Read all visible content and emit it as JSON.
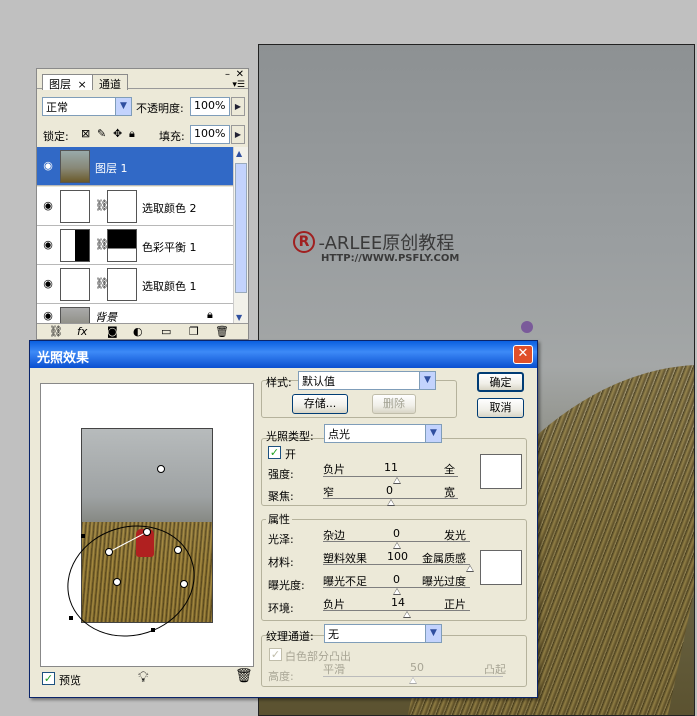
{
  "watermark": {
    "brand": "-ARLEE原创教程",
    "logo": "R",
    "url": "HTTP://WWW.PSFLY.COM"
  },
  "layers_panel": {
    "tabs": [
      "图层",
      "通道"
    ],
    "tab_close": "×",
    "blend_mode": "正常",
    "opacity_label": "不透明度:",
    "opacity_value": "100%",
    "lock_label": "锁定:",
    "fill_label": "填充:",
    "fill_value": "100%",
    "layers": [
      {
        "name": "图层 1",
        "selected": true
      },
      {
        "name": "选取颜色 2",
        "selected": false
      },
      {
        "name": "色彩平衡 1",
        "selected": false
      },
      {
        "name": "选取颜色 1",
        "selected": false
      },
      {
        "name": "背景",
        "selected": false
      }
    ]
  },
  "dialog": {
    "title": "光照效果",
    "close": "✕",
    "ok": "确定",
    "cancel": "取消",
    "style_label": "样式:",
    "style_value": "默认值",
    "save": "存储...",
    "delete": "删除",
    "light_type_label": "光照类型:",
    "light_type_value": "点光",
    "on_label": "开",
    "intensity": {
      "label": "强度:",
      "left": "负片",
      "value": "11",
      "right": "全",
      "level": 0.55
    },
    "focus": {
      "label": "聚焦:",
      "left": "窄",
      "value": "0",
      "right": "宽",
      "level": 0.5
    },
    "properties_label": "属性",
    "gloss": {
      "label": "光泽:",
      "left": "杂边",
      "value": "0",
      "right": "发光",
      "level": 0.5
    },
    "material": {
      "label": "材料:",
      "left": "塑料效果",
      "value": "100",
      "right": "金属质感",
      "level": 1.0
    },
    "exposure": {
      "label": "曝光度:",
      "left": "曝光不足",
      "value": "0",
      "right": "曝光过度",
      "level": 0.5
    },
    "ambience": {
      "label": "环境:",
      "left": "负片",
      "value": "14",
      "right": "正片",
      "level": 0.57
    },
    "texture_label": "纹理通道:",
    "texture_value": "无",
    "white_high_label": "白色部分凸出",
    "height": {
      "label": "高度:",
      "left": "平滑",
      "value": "50",
      "right": "凸起",
      "level": 0.5
    },
    "preview_label": "预览"
  }
}
